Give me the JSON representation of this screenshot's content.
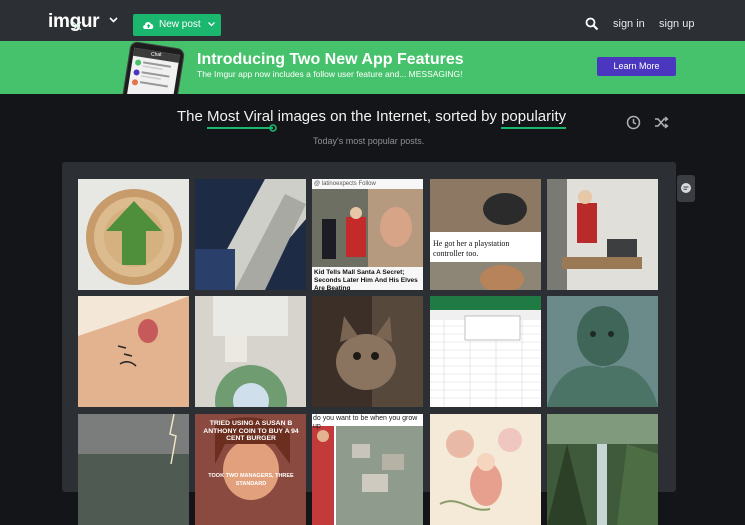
{
  "header": {
    "logo_text": "imgur",
    "new_post_label": "New post",
    "sign_in_label": "sign in",
    "sign_up_label": "sign up"
  },
  "banner": {
    "title": "Introducing Two New App Features",
    "subtitle": "The Imgur app now includes a follow user feature and... MESSAGING!",
    "learn_more_label": "Learn More",
    "phone_screen_title": "Chat"
  },
  "headline": {
    "prefix": "The",
    "section_value": "Most Viral",
    "middle": "images on the Internet, sorted by",
    "sort_value": "popularity"
  },
  "subheadline": "Today's most popular posts.",
  "tiles": {
    "t3_top": "@ latinoexpects  Follow",
    "t3_caption": "Kid Tells Mall Santa A Secret; Seconds Later Him And His Elves Are Beating",
    "t4_caption": "He got her a playstation controller too.",
    "t13_caption_top": "TRIED USING A SUSAN B ANTHONY COIN TO BUY A 94 CENT BURGER",
    "t13_caption_bottom": "TOOK TWO MANAGERS, THREE STANDARD",
    "t14_caption": "do you want to be when you grow up"
  },
  "colors": {
    "brand_green": "#1bb76e",
    "banner_green": "#46c26c",
    "learn_more_purple": "#4a36bf",
    "topbar": "#2c2f34",
    "page_bg": "#141518"
  }
}
